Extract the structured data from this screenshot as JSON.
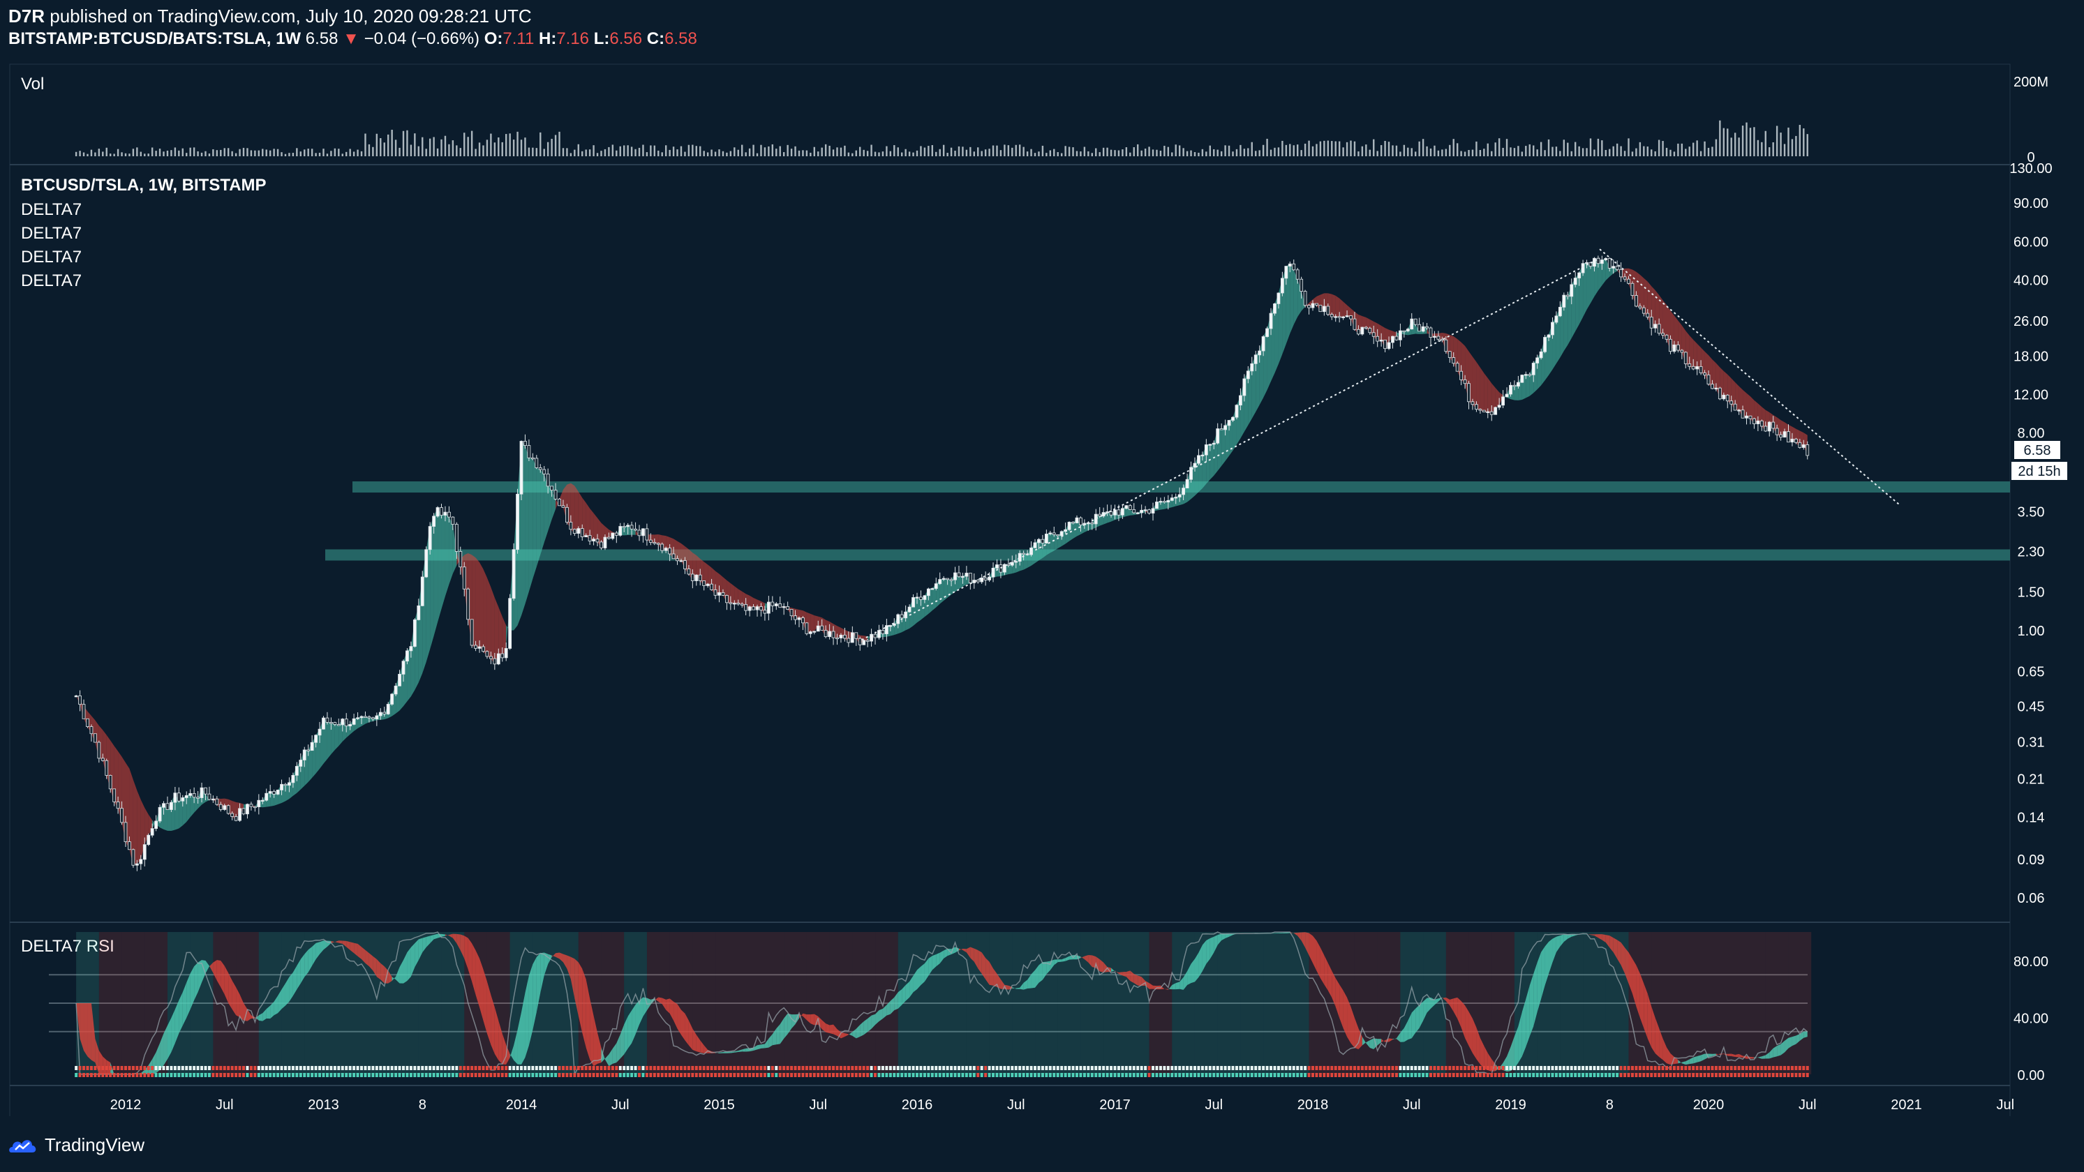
{
  "header": {
    "author": "D7R",
    "published": "published on TradingView.com, July 10, 2020 09:28:21 UTC",
    "symbol": "BITSTAMP:BTCUSD/BATS:TSLA, 1W",
    "last": "6.58",
    "change": "−0.04 (−0.66%)",
    "o_label": "O:",
    "o_value": "7.11",
    "h_label": "H:",
    "h_value": "7.16",
    "l_label": "L:",
    "l_value": "6.56",
    "c_label": "C:",
    "c_value": "6.58"
  },
  "panes": {
    "volume_title": "Vol",
    "main_title": "BTCUSD/TSLA, 1W, BITSTAMP",
    "indicators": [
      "DELTA7",
      "DELTA7",
      "DELTA7",
      "DELTA7"
    ],
    "rsi_title": "DELTA7 RSI"
  },
  "price_badges": {
    "last": "6.58",
    "countdown": "2d 15h"
  },
  "footer": {
    "brand": "TradingView"
  },
  "colors": {
    "background": "#0b1c2c",
    "bull": "#4fd1b8",
    "bear": "#e0463c",
    "zone": "#2f7d78",
    "text": "#ffffff",
    "accent_red": "#f0524f"
  },
  "chart_data": [
    {
      "type": "line",
      "pane": "main",
      "title": "BTCUSD/TSLA, 1W, BITSTAMP",
      "yscale": "log",
      "ylim": [
        0.06,
        130
      ],
      "x_ticks": [
        "2012",
        "Jul",
        "2013",
        "8",
        "2014",
        "Jul",
        "2015",
        "Jul",
        "2016",
        "Jul",
        "2017",
        "Jul",
        "2018",
        "Jul",
        "2019",
        "8",
        "2020",
        "Jul",
        "2021",
        "Jul"
      ],
      "y_ticks": [
        "130.00",
        "90.00",
        "60.00",
        "40.00",
        "26.00",
        "18.00",
        "12.00",
        "8.00",
        "3.50",
        "2.30",
        "1.50",
        "1.00",
        "0.65",
        "0.45",
        "0.31",
        "0.21",
        "0.14",
        "0.09",
        "0.06"
      ],
      "x": [
        2011.75,
        2011.85,
        2011.95,
        2012.05,
        2012.15,
        2012.25,
        2012.4,
        2012.55,
        2012.7,
        2012.85,
        2013.0,
        2013.15,
        2013.25,
        2013.32,
        2013.45,
        2013.55,
        2013.65,
        2013.75,
        2013.85,
        2013.92,
        2014.0,
        2014.1,
        2014.25,
        2014.4,
        2014.55,
        2014.7,
        2014.85,
        2015.0,
        2015.15,
        2015.3,
        2015.45,
        2015.6,
        2015.72,
        2015.85,
        2016.0,
        2016.15,
        2016.3,
        2016.45,
        2016.6,
        2016.75,
        2016.9,
        2017.0,
        2017.15,
        2017.3,
        2017.45,
        2017.6,
        2017.75,
        2017.88,
        2017.96,
        2018.05,
        2018.2,
        2018.35,
        2018.5,
        2018.65,
        2018.8,
        2018.9,
        2018.97,
        2019.1,
        2019.25,
        2019.35,
        2019.45,
        2019.55,
        2019.65,
        2019.8,
        2019.95,
        2020.05,
        2020.15,
        2020.25,
        2020.35,
        2020.45,
        2020.5
      ],
      "y": [
        0.5,
        0.3,
        0.16,
        0.08,
        0.14,
        0.17,
        0.18,
        0.14,
        0.17,
        0.22,
        0.38,
        0.38,
        0.38,
        0.45,
        0.9,
        3.5,
        3.2,
        0.9,
        0.7,
        0.8,
        7.0,
        5.5,
        3.0,
        2.5,
        3.0,
        2.5,
        1.8,
        1.4,
        1.2,
        1.3,
        1.0,
        0.95,
        0.9,
        1.0,
        1.4,
        1.8,
        1.7,
        2.0,
        2.4,
        3.0,
        3.2,
        3.5,
        3.5,
        4.0,
        6.5,
        10,
        22,
        50,
        32,
        30,
        25,
        20,
        25,
        22,
        11,
        10,
        12,
        15,
        30,
        45,
        50,
        45,
        30,
        20,
        15,
        12,
        10,
        9,
        8,
        7,
        6.58
      ],
      "annotations": [
        {
          "type": "zone",
          "level": 4.5
        },
        {
          "type": "zone",
          "level": 2.2
        },
        {
          "type": "trendline",
          "from": [
            2015.72,
            0.9
          ],
          "to": [
            2019.45,
            50
          ]
        },
        {
          "type": "trendline",
          "from": [
            2019.45,
            55
          ],
          "to": [
            2020.97,
            3.7
          ]
        }
      ]
    },
    {
      "type": "bar",
      "pane": "volume",
      "title": "Vol",
      "y_ticks": [
        "200M",
        "0"
      ],
      "ylim": [
        0,
        230
      ]
    },
    {
      "type": "line",
      "pane": "rsi",
      "title": "DELTA7 RSI",
      "y_ticks": [
        "80.00",
        "40.00",
        "0.00"
      ],
      "ylim": [
        0,
        100
      ]
    }
  ]
}
